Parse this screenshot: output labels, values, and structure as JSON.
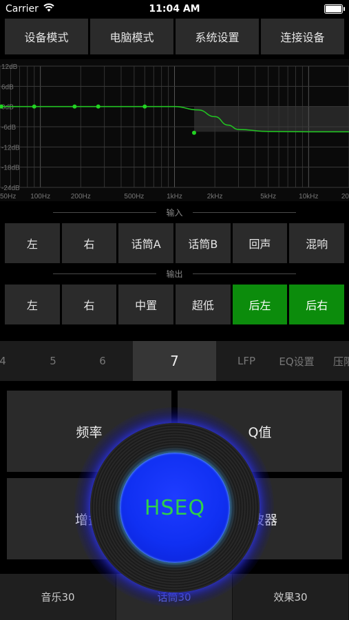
{
  "status": {
    "carrier": "Carrier",
    "time": "11:04 AM"
  },
  "top_tabs": [
    "设备模式",
    "电脑模式",
    "系统设置",
    "连接设备"
  ],
  "chart_data": {
    "type": "line",
    "y_ticks": [
      "12dB",
      "6dB",
      "0dB",
      "-6dB",
      "-12dB",
      "-18dB",
      "-24dB"
    ],
    "x_ticks": [
      "50Hz",
      "100Hz",
      "200Hz",
      "500Hz",
      "1kHz",
      "2kHz",
      "5kHz",
      "10kHz",
      "20"
    ],
    "ylim": [
      -24,
      12
    ],
    "xlim": [
      50,
      20000
    ],
    "log_x": true,
    "series": [
      {
        "x": [
          50,
          1000,
          1500,
          2000,
          2500,
          3000,
          5000,
          10000,
          20000
        ],
        "y": [
          0,
          0,
          -1,
          -3,
          -5.5,
          -6.8,
          -7.4,
          -7.5,
          -7.5
        ],
        "color": "#22c322"
      }
    ],
    "points": [
      {
        "x": 50,
        "y": 0
      },
      {
        "x": 90,
        "y": 0
      },
      {
        "x": 180,
        "y": 0
      },
      {
        "x": 270,
        "y": 0
      },
      {
        "x": 600,
        "y": 0
      },
      {
        "x": 1400,
        "y": -7.8
      }
    ],
    "highlight_range_x": [
      1400,
      20000
    ],
    "grid": true
  },
  "input_label": "输入",
  "input_buttons": [
    "左",
    "右",
    "话筒A",
    "话筒B",
    "回声",
    "混响"
  ],
  "output_label": "输出",
  "output_buttons": [
    {
      "label": "左",
      "active": false
    },
    {
      "label": "右",
      "active": false
    },
    {
      "label": "中置",
      "active": false
    },
    {
      "label": "超低",
      "active": false
    },
    {
      "label": "后左",
      "active": true
    },
    {
      "label": "后右",
      "active": true
    }
  ],
  "bands": [
    "4",
    "5",
    "6",
    "7",
    "LFP",
    "EQ设置",
    "压限"
  ],
  "selected_band": "7",
  "params": {
    "freq": "频率",
    "q": "Q值",
    "gain": "增益",
    "filter": "滤波器"
  },
  "knob_label": "HSEQ",
  "bottom_tabs": [
    "音乐30",
    "话筒30",
    "效果30"
  ],
  "selected_bottom_tab": "话筒30",
  "colors": {
    "accent_green": "#0c8c0c",
    "curve_green": "#22c322",
    "knob_blue": "#1030f2",
    "selected_tab_text": "#6e7cf0"
  }
}
